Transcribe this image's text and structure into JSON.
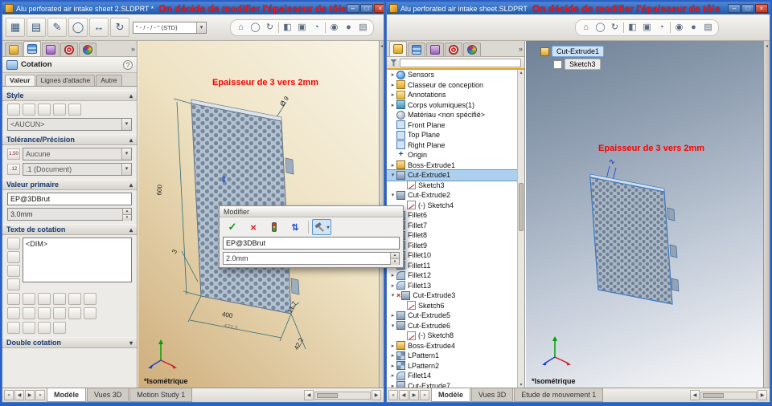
{
  "colors": {
    "accent_red": "#ff1414",
    "selection_blue": "#aed0ef",
    "titlebar_blue": "#1f58a8"
  },
  "icons": {
    "collapsed": "▸",
    "expanded": "▾",
    "chevron_up": "▴",
    "dropdown_arrow": "▾",
    "check": "✓",
    "cancel": "×",
    "error": "×",
    "help": "?",
    "minimize": "–",
    "maximize": "□",
    "close": "×",
    "tab_first": "«",
    "tab_left": "◀",
    "tab_right": "▶",
    "tab_last": "»",
    "overflow": "»",
    "collapse_pane": "◂"
  },
  "panel_tabs": [
    "featuremanager",
    "propertymanager",
    "configurationmanager",
    "dimxpertmanager",
    "displaymanager"
  ],
  "headsup_icons": [
    {
      "name": "zoom-fit-icon",
      "glyph": "⌂"
    },
    {
      "name": "zoom-area-icon",
      "glyph": "◯"
    },
    {
      "name": "previous-view-icon",
      "glyph": "↻"
    },
    {
      "name": "section-view-icon",
      "glyph": "◧"
    },
    {
      "name": "view-orientation-icon",
      "glyph": "▣"
    },
    {
      "name": "display-style-icon",
      "glyph": "◔"
    },
    {
      "name": "hide-show-items-icon",
      "glyph": "◉"
    },
    {
      "name": "edit-appearance-icon",
      "glyph": "●"
    },
    {
      "name": "scene-icon",
      "glyph": "▤"
    }
  ],
  "left_window": {
    "titlebar": {
      "title": "Alu perforated air intake sheet 2.SLDPRT *",
      "annotation": "On décide de modifier l'épaisseur de tôle"
    },
    "toolbar": {
      "feature_icons": [
        {
          "name": "extruded-boss-icon",
          "glyph": "▦"
        },
        {
          "name": "revolved-boss-icon",
          "glyph": "▤"
        },
        {
          "name": "sketch-icon",
          "glyph": "✎"
        },
        {
          "name": "circle-icon",
          "glyph": "◯"
        },
        {
          "name": "smart-dimension-icon",
          "glyph": "↔"
        },
        {
          "name": "rebuild-icon",
          "glyph": "↻"
        }
      ],
      "std_dropdown": "\" - / - / - \" (STD)"
    },
    "property_panel": {
      "header": "Cotation",
      "active_tab_index": 1,
      "value_tabs": [
        "Valeur",
        "Lignes d'attache",
        "Autre"
      ],
      "favorites_icons": [
        "apply-default-favorite",
        "add-favorite",
        "update-favorite",
        "save-favorite",
        "delete-favorite"
      ],
      "style": {
        "title": "Style",
        "favorite": "<AUCUN>"
      },
      "tolerance": {
        "title": "Tolérance/Précision",
        "tol_badge": "1.50",
        "type": "Aucune",
        "prec_badge": ".12",
        "precision": ".1 (Document)"
      },
      "primary": {
        "title": "Valeur primaire",
        "name": "EP@3DBrut",
        "value": "3.0mm"
      },
      "dim_text": {
        "title": "Texte de cotation",
        "value": "<DIM>",
        "side_buttons": [
          "dim-text-left",
          "dim-text-center",
          "dim-text-right",
          "dim-text-custom"
        ],
        "button_rows": [
          [
            "justify-left",
            "justify-center",
            "justify-right",
            "justify-top",
            "justify-middle",
            "justify-bottom"
          ],
          [
            "symbol-diameter",
            "symbol-degree",
            "symbol-plusminus",
            "symbol-centerline",
            "symbol-square",
            "more-symbols"
          ],
          [
            "dim-position-auto",
            "dim-position-broken",
            "dim-position-inline",
            "dim-position-offset"
          ]
        ]
      },
      "double_dim": {
        "title": "Double cotation"
      }
    },
    "viewport": {
      "annotation": "Epaisseur de 3 vers 2mm",
      "dims": {
        "height": "600",
        "width": "400",
        "width_dual": "423,3",
        "corner": "42,2",
        "edge": "11,7",
        "thickness": "3",
        "hole": "Ø 9"
      },
      "view_label": "*Isométrique"
    },
    "status_tabs": {
      "tabs": [
        "Modèle",
        "Vues 3D",
        "Motion Study 1"
      ],
      "active": 0
    }
  },
  "modify_dialog": {
    "title": "Modifier",
    "name": "EP@3DBrut",
    "value": "2.0mm"
  },
  "right_window": {
    "titlebar": {
      "title": "Alu perforated air intake sheet.SLDPRT",
      "annotation": "On décide de modifier l'épaisseur de tôle"
    },
    "breadcrumb": {
      "feature": "Cut-Extrude1",
      "sketch": "Sketch3"
    },
    "tree": {
      "items": [
        {
          "label": "Sensors",
          "icon": "sensors",
          "depth": 0,
          "arrow": "collapsed"
        },
        {
          "label": "Classeur de conception",
          "icon": "folder",
          "depth": 0,
          "arrow": "collapsed"
        },
        {
          "label": "Annotations",
          "icon": "annotations",
          "depth": 0,
          "arrow": "collapsed"
        },
        {
          "label": "Corps volumiques(1)",
          "icon": "bodies",
          "depth": 0,
          "arrow": "collapsed"
        },
        {
          "label": "Matériau <non spécifié>",
          "icon": "material",
          "depth": 0,
          "arrow": "none"
        },
        {
          "label": "Front Plane",
          "icon": "plane",
          "depth": 0,
          "arrow": "none"
        },
        {
          "label": "Top Plane",
          "icon": "plane",
          "depth": 0,
          "arrow": "none"
        },
        {
          "label": "Right Plane",
          "icon": "plane",
          "depth": 0,
          "arrow": "none"
        },
        {
          "label": "Origin",
          "icon": "origin",
          "depth": 0,
          "arrow": "none"
        },
        {
          "label": "Boss-Extrude1",
          "icon": "boss",
          "depth": 0,
          "arrow": "collapsed"
        },
        {
          "label": "Cut-Extrude1",
          "icon": "cut",
          "depth": 0,
          "arrow": "expanded",
          "selected": true
        },
        {
          "label": "Sketch3",
          "icon": "sketch",
          "depth": 1,
          "arrow": "none"
        },
        {
          "label": "Cut-Extrude2",
          "icon": "cut",
          "depth": 0,
          "arrow": "expanded"
        },
        {
          "label": "(-) Sketch4",
          "icon": "sketch",
          "depth": 1,
          "arrow": "none"
        },
        {
          "label": "Fillet6",
          "icon": "fillet",
          "depth": 0,
          "arrow": "collapsed"
        },
        {
          "label": "Fillet7",
          "icon": "fillet",
          "depth": 0,
          "arrow": "collapsed"
        },
        {
          "label": "Fillet8",
          "icon": "fillet",
          "depth": 0,
          "arrow": "collapsed"
        },
        {
          "label": "Fillet9",
          "icon": "fillet",
          "depth": 0,
          "arrow": "collapsed"
        },
        {
          "label": "Fillet10",
          "icon": "fillet",
          "depth": 0,
          "arrow": "collapsed"
        },
        {
          "label": "Fillet11",
          "icon": "fillet",
          "depth": 0,
          "arrow": "collapsed"
        },
        {
          "label": "Fillet12",
          "icon": "fillet",
          "depth": 0,
          "arrow": "collapsed"
        },
        {
          "label": "Fillet13",
          "icon": "fillet",
          "depth": 0,
          "arrow": "collapsed"
        },
        {
          "label": "Cut-Extrude3",
          "icon": "cut",
          "depth": 0,
          "arrow": "expanded",
          "error": true
        },
        {
          "label": "Sketch6",
          "icon": "sketch",
          "depth": 1,
          "arrow": "none"
        },
        {
          "label": "Cut-Extrude5",
          "icon": "cut",
          "depth": 0,
          "arrow": "collapsed"
        },
        {
          "label": "Cut-Extrude6",
          "icon": "cut",
          "depth": 0,
          "arrow": "expanded"
        },
        {
          "label": "(-) Sketch8",
          "icon": "sketch",
          "depth": 1,
          "arrow": "none"
        },
        {
          "label": "Boss-Extrude4",
          "icon": "boss",
          "depth": 0,
          "arrow": "collapsed"
        },
        {
          "label": "LPattern1",
          "icon": "pattern",
          "depth": 0,
          "arrow": "collapsed"
        },
        {
          "label": "LPattern2",
          "icon": "pattern",
          "depth": 0,
          "arrow": "collapsed"
        },
        {
          "label": "Fillet14",
          "icon": "fillet",
          "depth": 0,
          "arrow": "collapsed"
        },
        {
          "label": "Cut-Extrude7",
          "icon": "cut",
          "depth": 0,
          "arrow": "collapsed"
        }
      ]
    },
    "viewport": {
      "annotation": "Epaisseur de 3 vers 2mm",
      "edit_dim": "2",
      "view_label": "*Isométrique"
    },
    "status_tabs": {
      "tabs": [
        "Modèle",
        "Vues 3D",
        "Etude de mouvement 1"
      ],
      "active": 0
    }
  }
}
